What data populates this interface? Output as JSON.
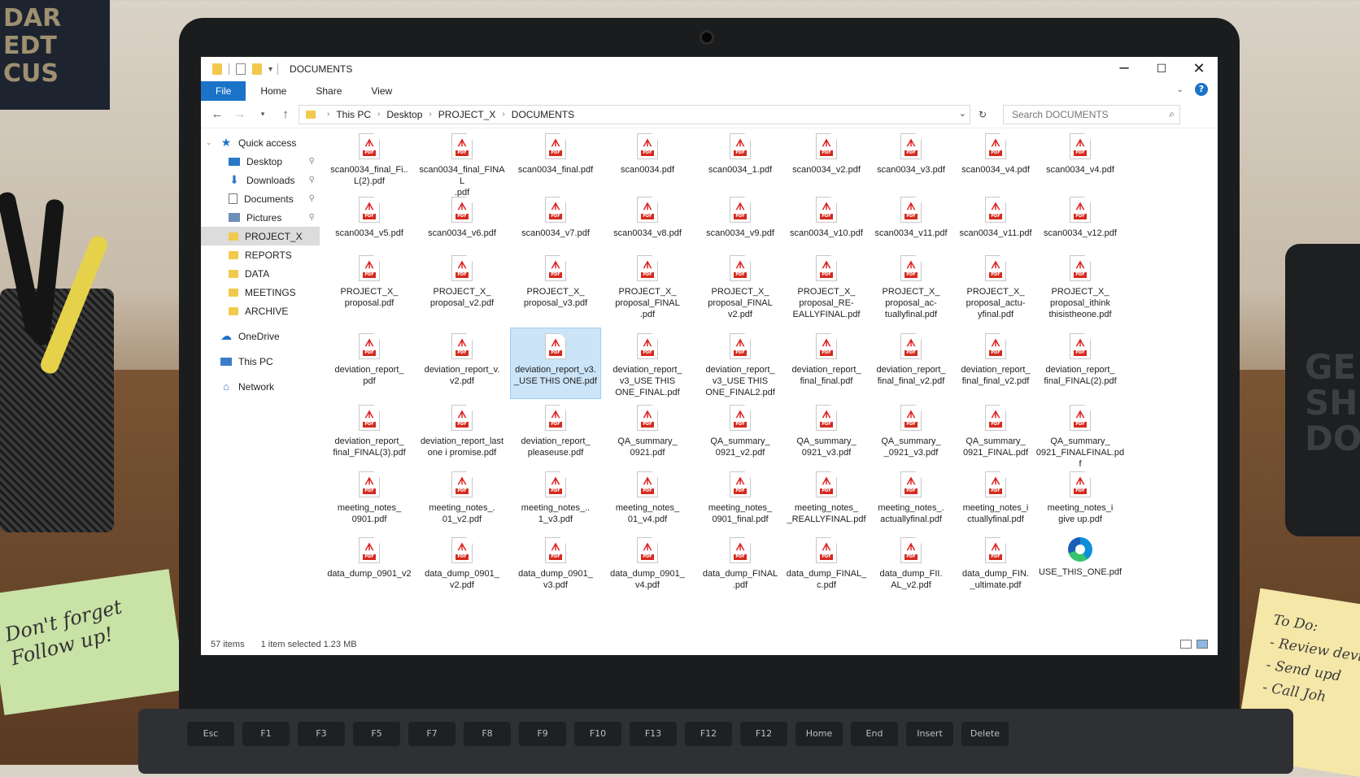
{
  "window": {
    "title": "DOCUMENTS",
    "controls": {
      "minimize": "─",
      "maximize": "☐",
      "close": "✕"
    }
  },
  "ribbon": {
    "tabs": [
      "File",
      "Home",
      "Share",
      "View"
    ],
    "help": "?"
  },
  "address": {
    "crumbs": [
      "This PC",
      "Desktop",
      "PROJECT_X",
      "DOCUMENTS"
    ],
    "search_placeholder": "Search DOCUMENTS"
  },
  "nav": {
    "items": [
      {
        "label": "Quick access",
        "icon": "star-icon"
      },
      {
        "label": "Desktop",
        "icon": "desktop-icon",
        "pinned": true
      },
      {
        "label": "Downloads",
        "icon": "download-arrow-icon",
        "pinned": true
      },
      {
        "label": "Documents",
        "icon": "documents-icon",
        "pinned": true
      },
      {
        "label": "Pictures",
        "icon": "pictures-icon",
        "pinned": true
      },
      {
        "label": "PROJECT_X",
        "icon": "folder-icon",
        "selected": true
      },
      {
        "label": "REPORTS",
        "icon": "folder-icon"
      },
      {
        "label": "DATA",
        "icon": "folder-icon"
      },
      {
        "label": "MEETINGS",
        "icon": "folder-icon"
      },
      {
        "label": "ARCHIVE",
        "icon": "folder-icon"
      },
      {
        "label": "OneDrive",
        "icon": "cloud-icon"
      },
      {
        "label": "This PC",
        "icon": "computer-icon"
      },
      {
        "label": "Network",
        "icon": "network-icon"
      }
    ]
  },
  "files": [
    [
      "scan0034_final_Fi..\nL(2).pdf",
      "scan0034_final_FINAL\n.pdf",
      "scan0034_final.pdf",
      "scan0034.pdf",
      "scan0034_1.pdf",
      "scan0034_v2.pdf",
      "scan0034_v3.pdf",
      "scan0034_v4.pdf",
      "scan0034_v4.pdf"
    ],
    [
      "scan0034_v5.pdf",
      "scan0034_v6.pdf",
      "scan0034_v7.pdf",
      "scan0034_v8.pdf",
      "scan0034_v9.pdf",
      "scan0034_v10.pdf",
      "scan0034_v11.pdf",
      "scan0034_v11.pdf",
      "scan0034_v12.pdf"
    ],
    [
      "PROJECT_X_\nproposal.pdf",
      "PROJECT_X_\nproposal_v2.pdf",
      "PROJECT_X_\nproposal_v3.pdf",
      "PROJECT_X_\nproposal_FINAL\n.pdf",
      "PROJECT_X_\nproposal_FINAL\nv2.pdf",
      "PROJECT_X_\nproposal_RE-\nEALLYFINAL.pdf",
      "PROJECT_X_\nproposal_ac-\ntuallyfinal.pdf",
      "PROJECT_X_\nproposal_actu-\nyfinal.pdf",
      "PROJECT_X_\nproposal_ithink\nthisistheone.pdf"
    ],
    [
      "deviation_report_\npdf",
      "deviation_report_v.\nv2.pdf",
      "deviation_report_v3.\n_USE THIS ONE.pdf",
      "deviation_report_\nv3_USE THIS\nONE_FINAL.pdf",
      "deviation_report_\nv3_USE THIS\nONE_FINAL2.pdf",
      "deviation_report_\nfinal_final.pdf",
      "deviation_report_\nfinal_final_v2.pdf",
      "deviation_report_\nfinal_final_v2.pdf",
      "deviation_report_\nfinal_FINAL(2).pdf"
    ],
    [
      "deviation_report_\nfinal_FINAL(3).pdf",
      "deviation_report_last\none i promise.pdf",
      "deviation_report_\npleaseuse.pdf",
      "QA_summary_\n0921.pdf",
      "QA_summary_\n0921_v2.pdf",
      "QA_summary_\n0921_v3.pdf",
      "QA_summary_\n_0921_v3.pdf",
      "QA_summary_\n0921_FINAL.pdf",
      "QA_summary_\n0921_FINALFINAL.pdf"
    ],
    [
      "meeting_notes_\n0901.pdf",
      "meeting_notes_.\n01_v2.pdf",
      "meeting_notes_..\n1_v3.pdf",
      "meeting_notes_\n01_v4.pdf",
      "meeting_notes_\n0901_final.pdf",
      "meeting_notes_\n_REALLYFINAL.pdf",
      "meeting_notes_.\nactuallyfinal.pdf",
      "meeting_notes_i\nctuallyfinal.pdf",
      "meeting_notes_i\ngive up.pdf"
    ],
    [
      "data_dump_0901_v2",
      "data_dump_0901_\nv2.pdf",
      "data_dump_0901_\nv3.pdf",
      "data_dump_0901_\nv4.pdf",
      "data_dump_FINAL\n.pdf",
      "data_dump_FINAL_\nc.pdf",
      "data_dump_FII.\nAL_v2.pdf",
      "data_dump_FIN.\n_ultimate.pdf",
      "USE_THIS_ONE.pdf"
    ]
  ],
  "selected_file": "deviation_report_v3.\n_USE THIS ONE.pdf",
  "status": {
    "count": "57 items",
    "selection": "1 item selected  1.23 MB"
  },
  "surroundings": {
    "poster": "DAR\nEDT\nCUS",
    "mug": "GE\nSH\nDO",
    "sticky": "Don't forget\nFollow up!",
    "notepad": "To Do:\n- Review devi\n- Send upd\n- Call Joh",
    "keys": [
      "Esc",
      "F1",
      "F3",
      "F5",
      "F7",
      "F8",
      "F9",
      "F10",
      "F13",
      "F12",
      "F12",
      "Home",
      "End",
      "Insert",
      "Delete"
    ]
  },
  "colors": {
    "accent": "#1a73c8",
    "selection": "#cce4f7",
    "pdf_red": "#d52b1e"
  }
}
